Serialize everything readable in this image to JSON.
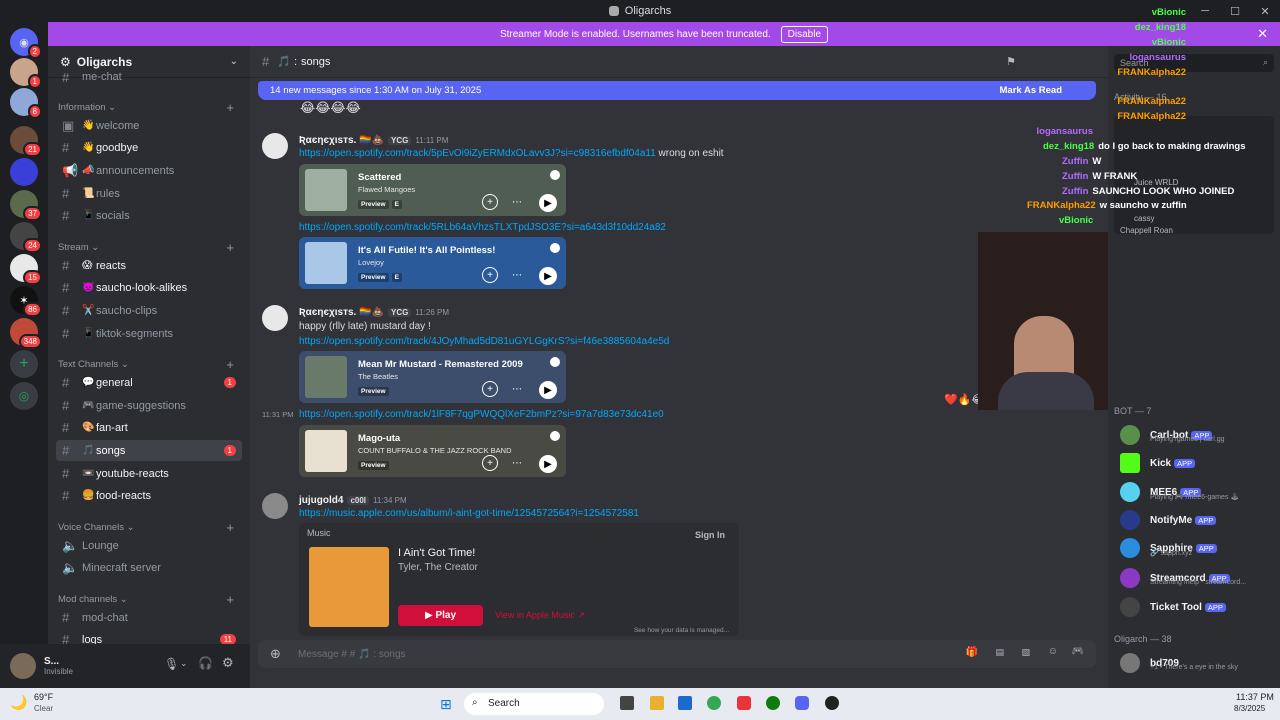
{
  "window": {
    "title": "Oligarchs"
  },
  "banner": {
    "text": "Streamer Mode is enabled. Usernames have been truncated.",
    "button": "Disable"
  },
  "server_badges": [
    "2",
    "1",
    "8",
    "21",
    "37",
    "24",
    "15",
    "86",
    "348"
  ],
  "guild": {
    "name": "Oligarchs"
  },
  "sidebar": {
    "top_partial": "me-chat",
    "categories": [
      "Information",
      "Stream",
      "Text Channels",
      "Voice Channels",
      "Mod channels"
    ],
    "channels": [
      {
        "label": "welcome",
        "icon": "👋",
        "unread": false
      },
      {
        "label": "goodbye",
        "icon": "👋",
        "unread": true
      },
      {
        "label": "announcements",
        "icon": "📣",
        "unread": false
      },
      {
        "label": "rules",
        "icon": "📜",
        "unread": false
      },
      {
        "label": "socials",
        "icon": "📱",
        "unread": false
      },
      {
        "label": "reacts",
        "icon": "😱",
        "unread": true
      },
      {
        "label": "saucho-look-alikes",
        "icon": "👿",
        "unread": true
      },
      {
        "label": "saucho-clips",
        "icon": "✂️",
        "unread": false
      },
      {
        "label": "tiktok-segments",
        "icon": "📱",
        "unread": false
      },
      {
        "label": "general",
        "icon": "💬",
        "unread": true,
        "badge": "1"
      },
      {
        "label": "game-suggestions",
        "icon": "🎮",
        "unread": false
      },
      {
        "label": "fan-art",
        "icon": "🎨",
        "unread": true
      },
      {
        "label": "songs",
        "icon": "🎵",
        "unread": true,
        "badge": "1",
        "selected": true
      },
      {
        "label": "youtube-reacts",
        "icon": "📼",
        "unread": true
      },
      {
        "label": "food-reacts",
        "icon": "🍔",
        "unread": true
      }
    ],
    "voice": [
      "Lounge",
      "Minecraft server"
    ],
    "mod": [
      {
        "label": "mod-chat"
      },
      {
        "label": "logs",
        "badge": "11"
      }
    ]
  },
  "user": {
    "name": "S...",
    "status": "Invisible"
  },
  "channel": {
    "name": "songs",
    "placeholder": "Message # # 🎵 : songs"
  },
  "new_messages": {
    "text": "14 new messages since 1:30 AM on July 31, 2025",
    "action": "Mark As Read"
  },
  "messages": [
    {
      "user": "Ʀαєηєχιѕтѕ. 🏳️‍🌈💩",
      "tag": "YCG",
      "time": "11:11 PM",
      "link1": "https://open.spotify.com/track/5pEvOi9iZyERMdxOLavv3J?si=c98316efbdf04a11",
      "link1_suffix": "wrong on eshit",
      "card1": {
        "title": "Scattered",
        "artist": "Flawed Mangoes"
      },
      "link2": "https://open.spotify.com/track/5RLb64aVhzsTLXTpdJSO3E?si=a643d3f10dd24a82",
      "card2": {
        "title": "It's All Futile! It's All Pointless!",
        "artist": "Lovejoy"
      }
    },
    {
      "user": "Ʀαєηєχιѕтѕ. 🏳️‍🌈💩",
      "tag": "YCG",
      "time": "11:26 PM",
      "text": "happy (rlly late) mustard day !",
      "link1": "https://open.spotify.com/track/4JOyMhad5dD81uGYLGgKrS?si=f46e3885604a4e5d",
      "card1": {
        "title": "Mean Mr Mustard - Remastered 2009",
        "artist": "The Beatles"
      },
      "time2": "11:31 PM",
      "link2": "https://open.spotify.com/track/1lF8F7qgPWQQlXeF2bmPz?si=97a7d83e73dc41e0",
      "card2": {
        "title": "Mago-uta",
        "artist": "COUNT BUFFALO & THE JAZZ ROCK BAND"
      }
    },
    {
      "user": "jujugold4",
      "tag": "c00l",
      "time": "11:34 PM",
      "link1": "https://music.apple.com/us/album/i-aint-got-time/1254572564?i=1254572581",
      "apple": {
        "brand": "Music",
        "title": "I Ain't Got Time!",
        "artist": "Tyler, The Creator",
        "play": "Play",
        "open": "View in Apple Music ↗",
        "signin": "Sign In",
        "footer": "See how your data is managed..."
      }
    }
  ],
  "preview_label": "Preview",
  "explicit": "E",
  "search": {
    "placeholder": "Search"
  },
  "activity": {
    "label": "Activity — 16"
  },
  "stream_chat": [
    {
      "user": "vBionic",
      "msg": "",
      "color": "#4aff4a"
    },
    {
      "user": "dez_king18",
      "msg": "",
      "color": "#4aff4a"
    },
    {
      "user": "vBionic",
      "msg": "",
      "color": "#4aff4a"
    },
    {
      "user": "logansaurus",
      "msg": "",
      "color": "#b36bff"
    },
    {
      "user": "FRANKalpha22",
      "msg": "",
      "color": "#ff9d00"
    },
    {
      "user": "FRANKalpha22",
      "msg": "",
      "color": "#ff9d00"
    },
    {
      "user": "FRANKalpha22",
      "msg": "",
      "color": "#ff9d00"
    },
    {
      "user": "logansaurus",
      "msg": "",
      "color": "#b36bff"
    },
    {
      "user": "dez_king18",
      "msg": "do I go back to making drawings",
      "color": "#4aff4a"
    },
    {
      "user": "Zuffin",
      "msg": "W",
      "color": "#b36bff"
    },
    {
      "user": "Zuffin",
      "msg": "W FRANK",
      "color": "#b36bff"
    },
    {
      "user": "Zuffin",
      "msg": "SAUNCHO LOOK WHO JOINED",
      "color": "#b36bff"
    },
    {
      "user": "FRANKalpha22",
      "msg": "w sauncho w zuffin",
      "color": "#ff9d00"
    },
    {
      "user": "vBionic",
      "msg": "",
      "color": "#4aff4a"
    }
  ],
  "activity_items": [
    "Juice WRLD",
    "cassy",
    "Chappell Roan"
  ],
  "members": {
    "bot_header": "BOT — 7",
    "bots": [
      {
        "name": "Carl-bot",
        "status": "Playing /games | carl.gg",
        "color": "#5a8f4a"
      },
      {
        "name": "Kick",
        "status": "",
        "color": "#53fc18"
      },
      {
        "name": "MEE6",
        "status": "Playing 🎮 /mee6-games 🕹",
        "color": "#58d0f0"
      },
      {
        "name": "NotifyMe",
        "status": "",
        "color": "#2a3a8a"
      },
      {
        "name": "Sapphire",
        "status": "🔗 sapph.xyz",
        "color": "#2b8ce0"
      },
      {
        "name": "Streamcord",
        "status": "Streaming /help - streamcord...",
        "color": "#8a3ac0"
      },
      {
        "name": "Ticket Tool",
        "status": "",
        "color": "#444"
      }
    ],
    "app_tag": "APP",
    "online_header": "Oligarch — 38",
    "online": [
      {
        "name": "bd709",
        "status": "+1 • There's a eye in the sky"
      }
    ]
  },
  "taskbar": {
    "weather_temp": "69°F",
    "weather_desc": "Clear",
    "search": "Search",
    "time": "11:37 PM",
    "date": "8/3/2025"
  }
}
